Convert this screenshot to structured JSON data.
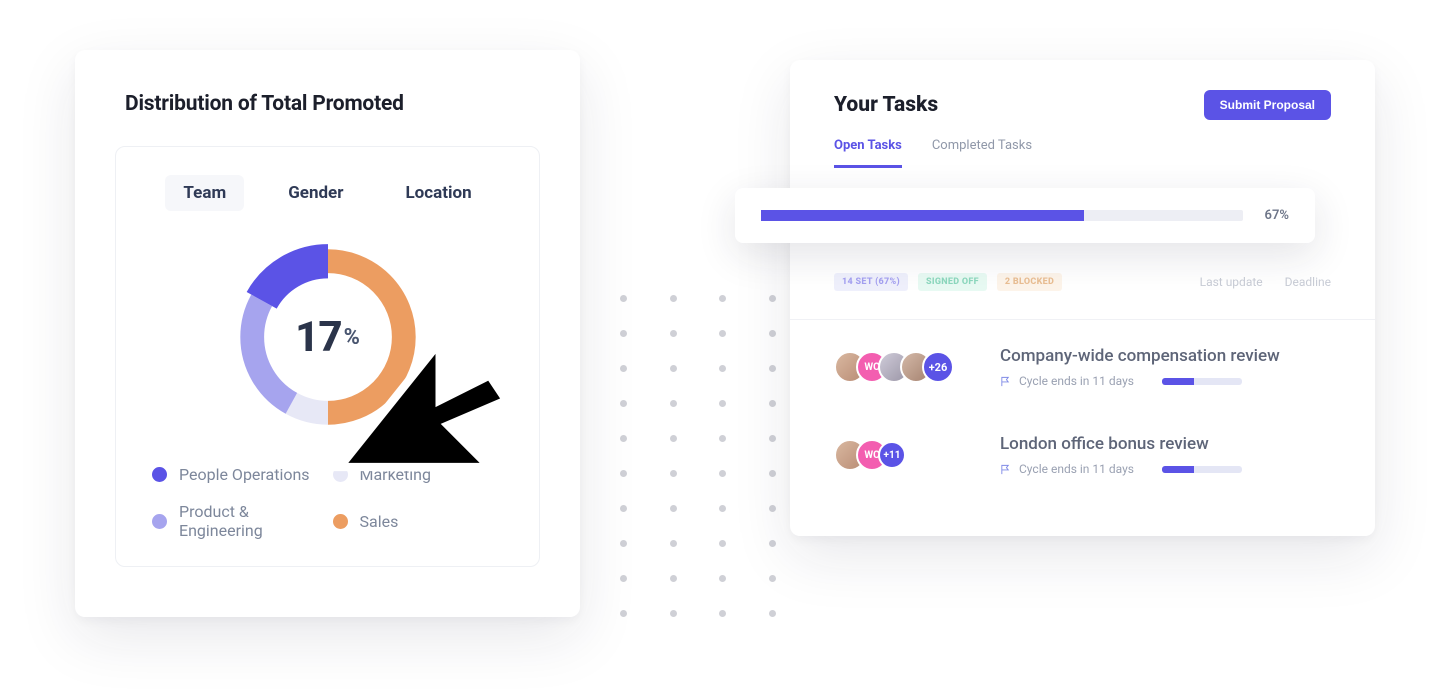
{
  "colors": {
    "primary": "#5b53e6",
    "primary_light": "#a6a4ee",
    "pale": "#e7e8f6",
    "orange": "#ec9d61",
    "pink": "#f35eb0",
    "text_dark": "#1c1f2b",
    "text_muted": "#7d879b"
  },
  "left_card": {
    "title": "Distribution of Total Promoted",
    "tabs": [
      {
        "label": "Team",
        "active": true
      },
      {
        "label": "Gender",
        "active": false
      },
      {
        "label": "Location",
        "active": false
      }
    ],
    "donut": {
      "value": "17",
      "unit": "%"
    },
    "legend": [
      {
        "label": "People Operations",
        "color": "#5b53e6"
      },
      {
        "label": "Marketing",
        "color": "#e7e8f6"
      },
      {
        "label": "Product & Engineering",
        "color": "#a6a4ee"
      },
      {
        "label": "Sales",
        "color": "#ec9d61"
      }
    ]
  },
  "chart_data": {
    "type": "pie",
    "title": "Distribution of Total Promoted",
    "series": [
      {
        "name": "People Operations",
        "value": 17,
        "color": "#5b53e6"
      },
      {
        "name": "Product & Engineering",
        "value": 25,
        "color": "#a6a4ee"
      },
      {
        "name": "Marketing",
        "value": 8,
        "color": "#e7e8f6"
      },
      {
        "name": "Sales",
        "value": 50,
        "color": "#ec9d61"
      }
    ],
    "highlighted": "People Operations",
    "center_label": "17%"
  },
  "right_card": {
    "title": "Your Tasks",
    "cta": "Submit Proposal",
    "tabs": [
      {
        "label": "Open Tasks",
        "active": true
      },
      {
        "label": "Completed Tasks",
        "active": false
      }
    ],
    "progress": {
      "percent": 67,
      "label": "67%"
    },
    "status_chips": [
      {
        "label": "14 SET (67%)",
        "variant": "blue"
      },
      {
        "label": "SIGNED OFF",
        "variant": "green"
      },
      {
        "label": "2 BLOCKED",
        "variant": "orange"
      }
    ],
    "status_right": [
      "Last update",
      "Deadline"
    ],
    "tasks": [
      {
        "title": "Company-wide compensation review",
        "meta": "Cycle ends in 11 days",
        "progress": 40,
        "avatars": [
          "photo1",
          "pink:WC",
          "photo2",
          "photo3",
          "indigo:+26"
        ]
      },
      {
        "title": "London office bonus review",
        "meta": "Cycle ends in 11 days",
        "progress": 40,
        "avatars": [
          "photo1",
          "pink:WC",
          "indigo-sm:+11"
        ]
      }
    ]
  }
}
